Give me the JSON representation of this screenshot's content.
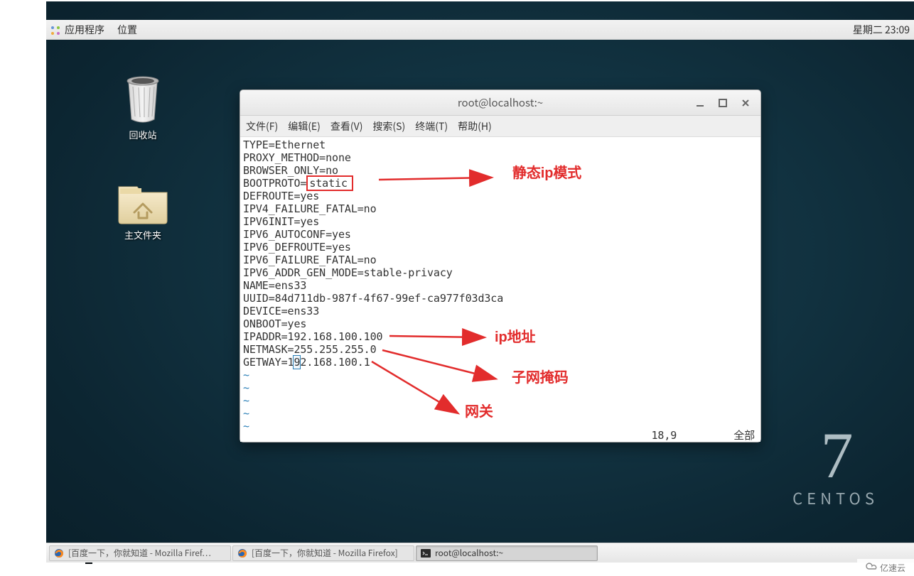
{
  "panel": {
    "applications": "应用程序",
    "places": "位置",
    "clock": "星期二 23:09"
  },
  "desktop": {
    "trash": "回收站",
    "home": "主文件夹",
    "centos_label": "CENTOS",
    "centos_num": "7"
  },
  "terminal": {
    "title": "root@localhost:~",
    "menus": {
      "file": "文件(F)",
      "edit": "编辑(E)",
      "view": "查看(V)",
      "search": "搜索(S)",
      "terminal": "终端(T)",
      "help": "帮助(H)"
    },
    "lines": {
      "l01a": "TYPE=Ethernet",
      "l02a": "PROXY_METHOD=none",
      "l03a": "BROWSER_ONLY=no",
      "l04a": "BOOTPROTO=",
      "l04b": "static",
      "l05a": "DEFROUTE=yes",
      "l06a": "IPV4_FAILURE_FATAL=no",
      "l07a": "IPV6INIT=yes",
      "l08a": "IPV6_AUTOCONF=yes",
      "l09a": "IPV6_DEFROUTE=yes",
      "l10a": "IPV6_FAILURE_FATAL=no",
      "l11a": "IPV6_ADDR_GEN_MODE=stable-privacy",
      "l12a": "NAME=ens33",
      "l13a": "UUID=84d711db-987f-4f67-99ef-ca977f03d3ca",
      "l14a": "DEVICE=ens33",
      "l15a": "ONBOOT=yes",
      "l16a": "IPADDR=192.168.100.100",
      "l17a": "NETMASK=255.255.255.0",
      "l18a": "GETWAY=1",
      "l18b": "9",
      "l18c": "2.168.100.1"
    },
    "tilde": "~",
    "status_pos": "18,9",
    "status_all": "全部"
  },
  "annotations": {
    "static_ip": "静态ip模式",
    "ip_addr": "ip地址",
    "netmask": "子网掩码",
    "gateway": "网关"
  },
  "taskbar": {
    "t1": "[百度一下，你就知道 - Mozilla Firef…",
    "t2": "[百度一下，你就知道 - Mozilla Firefox]",
    "t3": "root@localhost:~"
  },
  "watermark": "亿速云"
}
